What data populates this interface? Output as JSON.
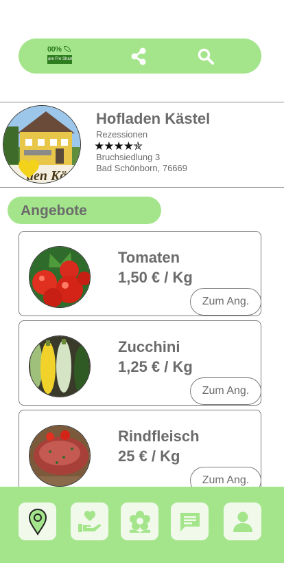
{
  "topbar": {
    "logo": {
      "percent": "00%",
      "strip_text": "are Fre Sharr",
      "icon": "leaf-icon"
    },
    "share_icon": "share-icon",
    "search_icon": "search-icon"
  },
  "shop": {
    "name": "Hofladen Kästel",
    "reviews_label": "Rezessionen",
    "rating": 4.5,
    "stars": "★★★★✯",
    "street": "Bruchsiedlung 3",
    "city": "Bad Schönborn, 76669",
    "avatar_sign_text": "den Kä",
    "favorite_icon": "heart-icon"
  },
  "section": {
    "title": "Angebote"
  },
  "offers": [
    {
      "name": "Tomaten",
      "price": "1,50 € / Kg",
      "button": "Zum Ang."
    },
    {
      "name": "Zucchini",
      "price": "1,25 € / Kg",
      "button": "Zum Ang."
    },
    {
      "name": "Rindfleisch",
      "price": "25 € / Kg",
      "button": "Zum Ang."
    }
  ],
  "nav": {
    "items": [
      {
        "icon": "map-pin-icon"
      },
      {
        "icon": "hand-heart-icon"
      },
      {
        "icon": "flower-icon"
      },
      {
        "icon": "chat-icon"
      },
      {
        "icon": "user-icon"
      }
    ]
  },
  "colors": {
    "accent_green": "#a4e58c",
    "nav_button_bg": "#f0f9ea",
    "text_gray": "#6b6b6b",
    "heart_yellow": "#f2d21b"
  }
}
